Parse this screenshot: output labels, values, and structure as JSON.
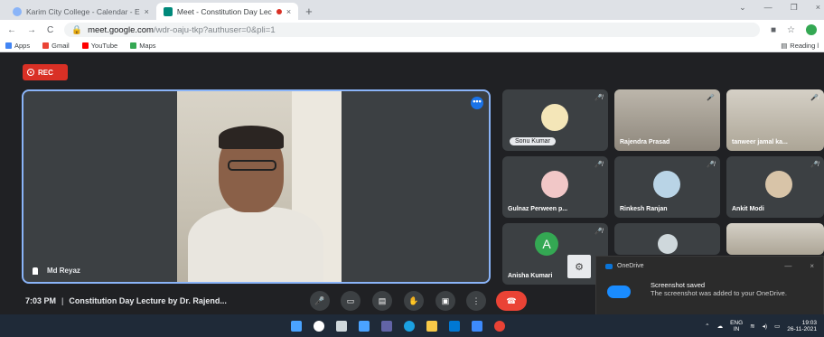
{
  "browser": {
    "tabs": [
      {
        "label": "Karim City College - Calendar - E",
        "close": "×"
      },
      {
        "label": "Meet - Constitution Day Lec",
        "close": "×"
      }
    ],
    "new_tab": "+",
    "window_controls": [
      "⌄",
      "—",
      "❐",
      "×"
    ],
    "url_host": "meet.google.com",
    "url_path": "/wdr-oaju-tkp?authuser=0&pli=1",
    "bookmarks": [
      {
        "label": "Apps",
        "color": "#4285f4"
      },
      {
        "label": "Gmail",
        "color": "#ea4335"
      },
      {
        "label": "YouTube",
        "color": "#ff0000"
      },
      {
        "label": "Maps",
        "color": "#34a853"
      }
    ],
    "reading_list": "Reading l"
  },
  "meet": {
    "rec_label": "REC",
    "main_speaker": "Md Reyaz",
    "more_options": "•••",
    "participants": [
      {
        "name": "Sonu Kumar",
        "mic": "🎤̸"
      },
      {
        "name": "Rajendra Prasad",
        "mic": "🎤"
      },
      {
        "name": "tanweer jamal ka...",
        "mic": "🎤̸"
      },
      {
        "name": "Gulnaz Perween p...",
        "mic": "🎤̸"
      },
      {
        "name": "Rinkesh Ranjan",
        "mic": "🎤̸"
      },
      {
        "name": "Ankit Modi",
        "mic": "🎤̸"
      },
      {
        "name": "Anisha Kumari",
        "mic": "🎤̸",
        "initial": "A"
      },
      {
        "name": "",
        "mic": ""
      },
      {
        "name": "",
        "mic": ""
      }
    ],
    "time": "7:03 PM",
    "separator": "|",
    "meeting_title": "Constitution Day Lecture by Dr. Rajend...",
    "controls": [
      "🎤",
      "▭",
      "▤",
      "✋",
      "▣",
      "⋮",
      "☎"
    ]
  },
  "toast": {
    "app": "OneDrive",
    "title": "Screenshot saved",
    "body": "The screenshot was added to your OneDrive.",
    "controls": [
      "—",
      "×"
    ]
  },
  "taskbar": {
    "icons": [
      {
        "name": "windows",
        "color": "#4aa3ff"
      },
      {
        "name": "search",
        "color": "#ffffff"
      },
      {
        "name": "task-view",
        "color": "#cfd8dc"
      },
      {
        "name": "widgets",
        "color": "#4aa3ff"
      },
      {
        "name": "teams",
        "color": "#6264a7"
      },
      {
        "name": "edge",
        "color": "#1ba1e2"
      },
      {
        "name": "file-explorer",
        "color": "#f7c948"
      },
      {
        "name": "mail",
        "color": "#0078d4"
      },
      {
        "name": "store",
        "color": "#3d8bfd"
      },
      {
        "name": "chrome",
        "color": "#e94235"
      }
    ],
    "lang_top": "ENG",
    "lang_bottom": "IN",
    "time": "19:03",
    "date": "26-11-2021"
  }
}
